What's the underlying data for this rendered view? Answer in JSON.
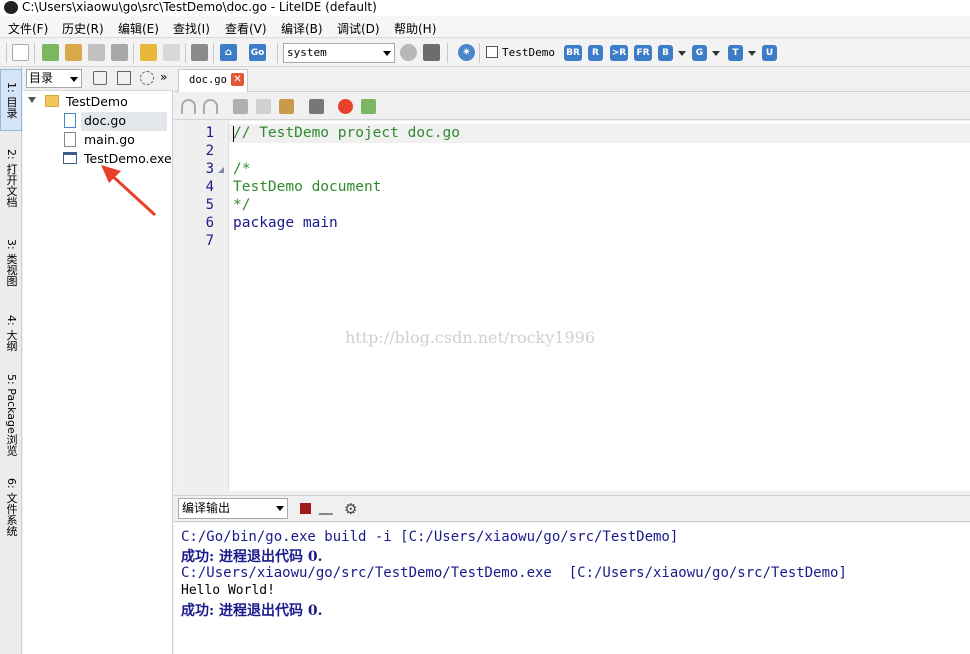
{
  "window": {
    "title": "C:\\Users\\xiaowu\\go\\src\\TestDemo\\doc.go - LiteIDE (default)"
  },
  "menubar": {
    "items": [
      {
        "label": "文件(F)"
      },
      {
        "label": "历史(R)"
      },
      {
        "label": "编辑(E)"
      },
      {
        "label": "查找(I)"
      },
      {
        "label": "查看(V)"
      },
      {
        "label": "编译(B)"
      },
      {
        "label": "调试(D)"
      },
      {
        "label": "帮助(H)"
      }
    ]
  },
  "toolbar": {
    "go_badge": "Go",
    "env_select": "system",
    "build_target_label": "TestDemo",
    "build_buttons": [
      "BR",
      "R",
      ">R",
      "FR",
      "B",
      "G",
      "T",
      "U"
    ]
  },
  "left_rail": {
    "tabs": [
      "1: 目录",
      "2: 打开文档",
      "3: 类视图",
      "4: 大纲",
      "5: Package浏览",
      "6: 文件系统"
    ]
  },
  "tree": {
    "view_select": "目录",
    "root": "TestDemo",
    "files": [
      "doc.go",
      "main.go",
      "TestDemo.exe"
    ]
  },
  "editor": {
    "tab_label": "doc.go",
    "line_numbers": [
      "1",
      "2",
      "3",
      "4",
      "5",
      "6",
      "7"
    ],
    "lines": [
      "// TestDemo project doc.go",
      "",
      "/*",
      "TestDemo document",
      "*/",
      "package main",
      ""
    ]
  },
  "watermark": "http://blog.csdn.net/rocky1996",
  "output": {
    "panel_select": "编译输出",
    "lines": [
      "C:/Go/bin/go.exe build -i [C:/Users/xiaowu/go/src/TestDemo]",
      "成功: 进程退出代码 0.",
      "C:/Users/xiaowu/go/src/TestDemo/TestDemo.exe  [C:/Users/xiaowu/go/src/TestDemo]",
      "Hello World!",
      "成功: 进程退出代码 0."
    ]
  },
  "colors": {
    "accent": "#3d7cc7",
    "comment": "#2e8b2e",
    "keyword": "#1a1a8c",
    "arrow": "#e8402a"
  }
}
